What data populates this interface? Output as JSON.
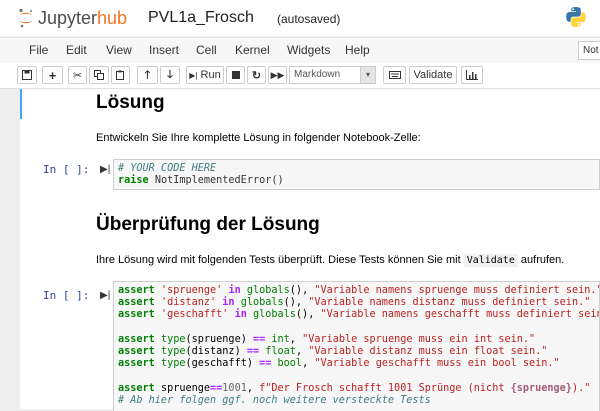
{
  "header": {
    "logo_text_prefix": "Jupyter",
    "logo_text_suffix": "hub",
    "notebook_title": "PVL1a_Frosch",
    "autosave_status": "(autosaved)",
    "kernel_logo_icon": "python-logo-icon"
  },
  "menubar": {
    "items": [
      "File",
      "Edit",
      "View",
      "Insert",
      "Cell",
      "Kernel",
      "Widgets",
      "Help"
    ],
    "kernel_indicator": "Not"
  },
  "toolbar": {
    "icons": [
      "save-icon",
      "plus-icon",
      "scissors-icon",
      "copy-icon",
      "paste-icon",
      "arrow-up-icon",
      "arrow-down-icon",
      "step-forward-icon",
      "stop-icon",
      "restart-icon",
      "fast-forward-icon",
      "keyboard-icon",
      "chart-icon"
    ],
    "run_label": "Run",
    "cell_type": "Markdown",
    "validate_label": "Validate"
  },
  "cells": {
    "heading1": "Lösung",
    "text1": "Entwickeln Sie Ihre komplette Lösung in folgender Notebook-Zelle:",
    "prompt1": "In [ ]:",
    "heading2": "Überprüfung der Lösung",
    "text2_before": "Ihre Lösung wird mit folgenden Tests überprüft. Diese Tests können Sie mit",
    "text2_code": "Validate",
    "text2_after": "aufrufen.",
    "prompt2": "In [ ]:"
  },
  "colors": {
    "accent_blue": "#42a5f5",
    "jupyter_orange": "#f37524",
    "prompt_blue": "#303f9f"
  }
}
